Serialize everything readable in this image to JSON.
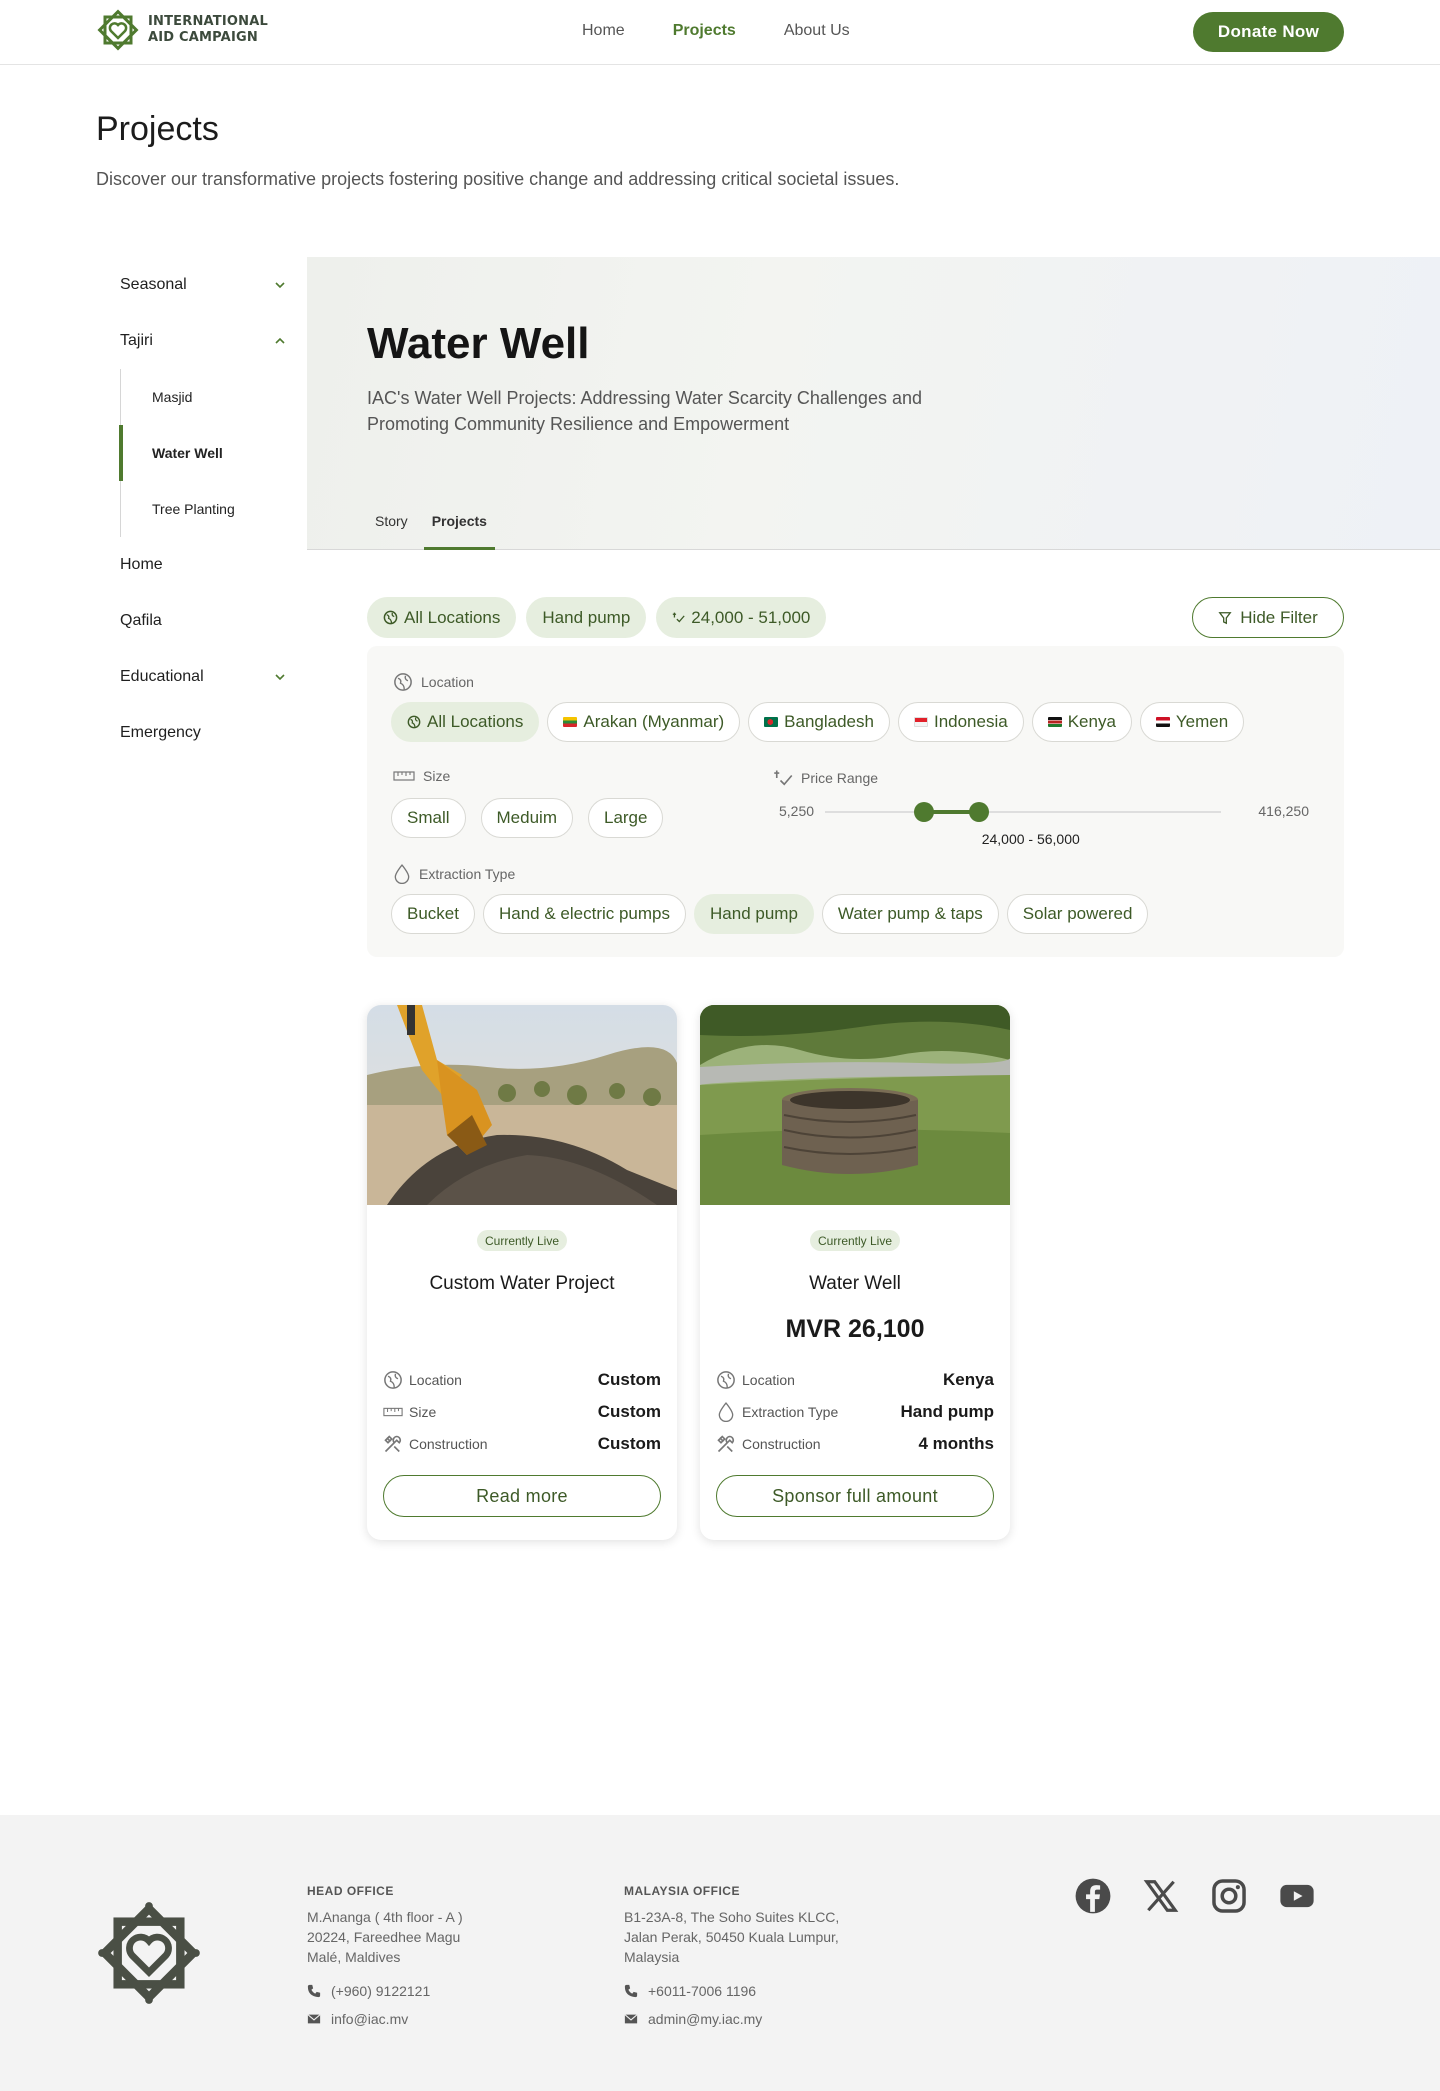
{
  "header": {
    "logo_line1": "INTERNATIONAL",
    "logo_line2": "AID CAMPAIGN",
    "nav": [
      "Home",
      "Projects",
      "About Us"
    ],
    "active_nav": "Projects",
    "donate_label": "Donate Now"
  },
  "page": {
    "title": "Projects",
    "subtitle": "Discover our transformative projects fostering positive change and addressing critical societal issues."
  },
  "sidebar": {
    "items": [
      {
        "label": "Seasonal",
        "chevron": "down"
      },
      {
        "label": "Tajiri",
        "chevron": "up",
        "children": [
          "Masjid",
          "Water Well",
          "Tree Planting"
        ],
        "active_child": "Water Well"
      },
      {
        "label": "Home"
      },
      {
        "label": "Qafila"
      },
      {
        "label": "Educational",
        "chevron": "down"
      },
      {
        "label": "Emergency"
      }
    ]
  },
  "hero": {
    "title": "Water Well",
    "description": "IAC's Water Well Projects: Addressing Water Scarcity Challenges and Promoting Community Resilience and Empowerment",
    "tabs": [
      "Story",
      "Projects"
    ],
    "active_tab": "Projects"
  },
  "active_filters": {
    "chips": [
      "All Locations",
      "Hand pump",
      "24,000 - 51,000"
    ],
    "hide_filter_label": "Hide Filter"
  },
  "filters": {
    "location": {
      "label": "Location",
      "options": [
        "All Locations",
        "Arakan (Myanmar)",
        "Bangladesh",
        "Indonesia",
        "Kenya",
        "Yemen"
      ],
      "selected": "All Locations"
    },
    "size": {
      "label": "Size",
      "options": [
        "Small",
        "Meduim",
        "Large"
      ]
    },
    "price_range": {
      "label": "Price Range",
      "min": "5,250",
      "max": "416,250",
      "min_value": 5250,
      "max_value": 416250,
      "low": 24000,
      "high": 56000,
      "readout": "24,000 - 56,000"
    },
    "extraction": {
      "label": "Extraction Type",
      "options": [
        "Bucket",
        "Hand & electric pumps",
        "Hand pump",
        "Water pump & taps",
        "Solar powered"
      ],
      "selected": "Hand pump"
    }
  },
  "cards": [
    {
      "badge": "Currently Live",
      "title": "Custom Water Project",
      "price": "",
      "specs": [
        {
          "icon": "globe-icon",
          "label": "Location",
          "value": "Custom"
        },
        {
          "icon": "ruler-icon",
          "label": "Size",
          "value": "Custom"
        },
        {
          "icon": "tools-icon",
          "label": "Construction",
          "value": "Custom"
        }
      ],
      "button": "Read more"
    },
    {
      "badge": "Currently Live",
      "title": "Water Well",
      "price": "MVR 26,100",
      "specs": [
        {
          "icon": "globe-icon",
          "label": "Location",
          "value": "Kenya"
        },
        {
          "icon": "drop-icon",
          "label": "Extraction Type",
          "value": "Hand pump"
        },
        {
          "icon": "tools-icon",
          "label": "Construction",
          "value": "4 months"
        }
      ],
      "button": "Sponsor full amount"
    }
  ],
  "footer": {
    "head_office": {
      "title": "HEAD OFFICE",
      "address": [
        "M.Ananga ( 4th floor - A )",
        "20224, Fareedhee Magu",
        "Malé, Maldives"
      ],
      "phone": "(+960) 9122121",
      "email": "info@iac.mv"
    },
    "malaysia_office": {
      "title": "MALAYSIA OFFICE",
      "address": [
        "B1-23A-8, The Soho Suites KLCC,",
        "Jalan Perak, 50450 Kuala Lumpur,",
        "Malaysia"
      ],
      "phone": "+6011-7006 1196",
      "email": "admin@my.iac.my"
    },
    "socials": [
      "facebook-icon",
      "x-icon",
      "instagram-icon",
      "youtube-icon"
    ]
  },
  "colors": {
    "brand_green": "#4f7a2f",
    "chip_bg": "#e6eedf",
    "footer_bg": "#f3f3f3"
  }
}
